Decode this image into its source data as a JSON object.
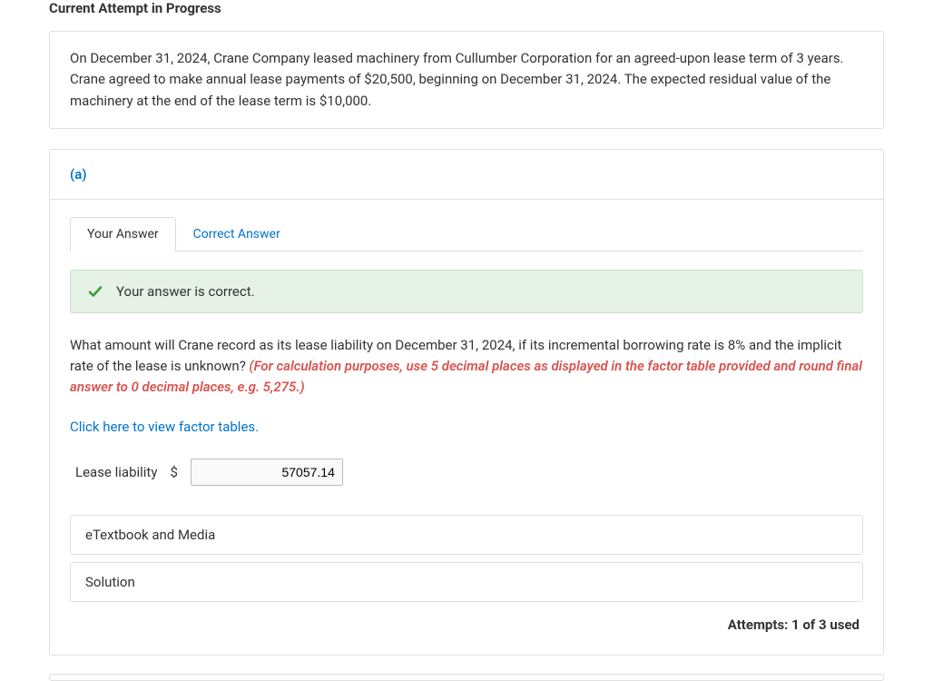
{
  "header": {
    "attempt_status": "Current Attempt in Progress"
  },
  "problem": {
    "text": "On December 31, 2024, Crane Company leased machinery from Cullumber Corporation for an agreed-upon lease term of 3 years. Crane agreed to make annual lease payments of $20,500, beginning on December 31, 2024. The expected residual value of the machinery at the end of the lease term is $10,000."
  },
  "part": {
    "label": "(a)",
    "tabs": {
      "your_answer": "Your Answer",
      "correct_answer": "Correct Answer"
    },
    "banner": {
      "message": "Your answer is correct."
    },
    "question": "What amount will Crane record as its lease liability on December 31, 2024, if its incremental borrowing rate is 8% and the implicit rate of the lease is unknown? ",
    "instruction": "(For calculation purposes, use 5 decimal places as displayed in the factor table provided and round final answer to 0 decimal places, e.g. 5,275.)",
    "factor_link": "Click here to view factor tables.",
    "answer": {
      "label": "Lease liability",
      "currency": "$",
      "value": "57057.14"
    },
    "accordion": {
      "etextbook": "eTextbook and Media",
      "solution": "Solution"
    },
    "attempts": "Attempts: 1 of 3 used"
  }
}
